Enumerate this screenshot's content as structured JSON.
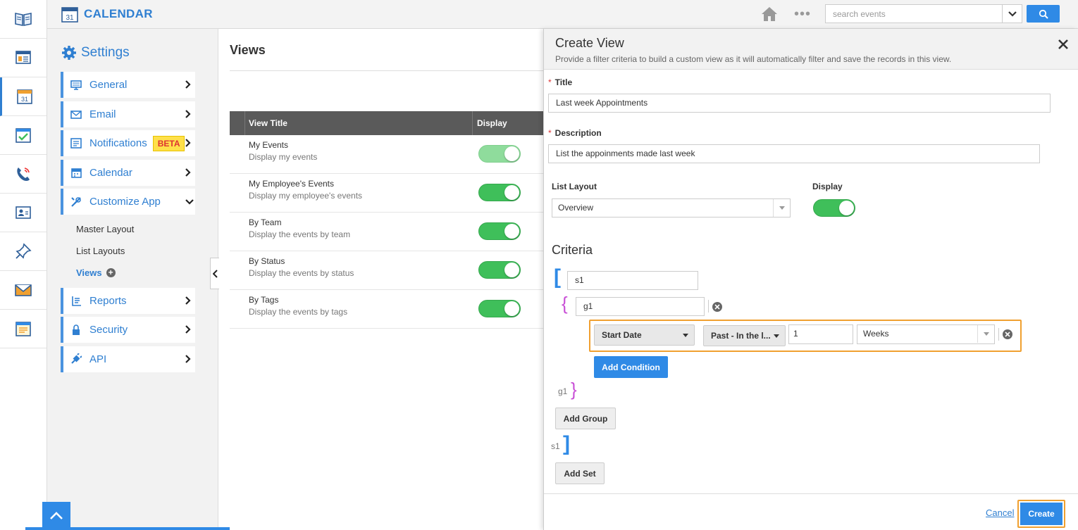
{
  "app": {
    "title": "CALENDAR",
    "calendar_day": "31"
  },
  "header": {
    "search_placeholder": "search events",
    "more": "•••"
  },
  "rail": {
    "icons": [
      "book-icon",
      "dashboard-icon",
      "calendar-icon",
      "checklist-icon",
      "phone-icon",
      "contact-card-icon",
      "pin-icon",
      "mail-icon",
      "notes-icon"
    ],
    "active_index": 2
  },
  "settings": {
    "title": "Settings",
    "menu": [
      {
        "label": "General",
        "icon": "monitor-icon"
      },
      {
        "label": "Email",
        "icon": "envelope-icon"
      },
      {
        "label": "Notifications",
        "icon": "notification-icon",
        "badge": "BETA"
      },
      {
        "label": "Calendar",
        "icon": "calendar-small-icon"
      },
      {
        "label": "Customize App",
        "icon": "tools-icon",
        "expanded": true
      }
    ],
    "submenu": [
      "Master Layout",
      "List Layouts",
      "Views"
    ],
    "menu2": [
      {
        "label": "Reports",
        "icon": "reports-icon"
      },
      {
        "label": "Security",
        "icon": "lock-icon"
      },
      {
        "label": "API",
        "icon": "plug-icon"
      }
    ]
  },
  "views": {
    "title": "Views",
    "columns": [
      "View Title",
      "Display"
    ],
    "rows": [
      {
        "title": "My Events",
        "desc": "Display my events",
        "on": true
      },
      {
        "title": "My Employee's Events",
        "desc": "Display my employee's events",
        "on": true
      },
      {
        "title": "By Team",
        "desc": "Display the events by team",
        "on": true
      },
      {
        "title": "By Status",
        "desc": "Display the events by status",
        "on": true
      },
      {
        "title": "By Tags",
        "desc": "Display the events by tags",
        "on": true
      }
    ]
  },
  "create_view": {
    "title": "Create View",
    "subtitle": "Provide a filter criteria to build a custom view as it will automatically filter and save the records in this view.",
    "title_label": "Title",
    "title_value": "Last week Appointments",
    "desc_label": "Description",
    "desc_value": "List the appoinments made last week",
    "list_layout_label": "List Layout",
    "list_layout_value": "Overview",
    "display_label": "Display",
    "criteria_title": "Criteria",
    "set_name": "s1",
    "group_name": "g1",
    "condition": {
      "field": "Start Date",
      "operator": "Past - In the l...",
      "value": "1",
      "unit": "Weeks"
    },
    "add_condition": "Add Condition",
    "add_group": "Add Group",
    "add_set": "Add Set",
    "cancel": "Cancel",
    "create": "Create"
  },
  "colors": {
    "accent": "#2f7fd1",
    "button": "#2f8ae6",
    "toggle_on": "#3fbf5a",
    "highlight": "#f0a030",
    "group_bracket": "#c84fd6"
  }
}
